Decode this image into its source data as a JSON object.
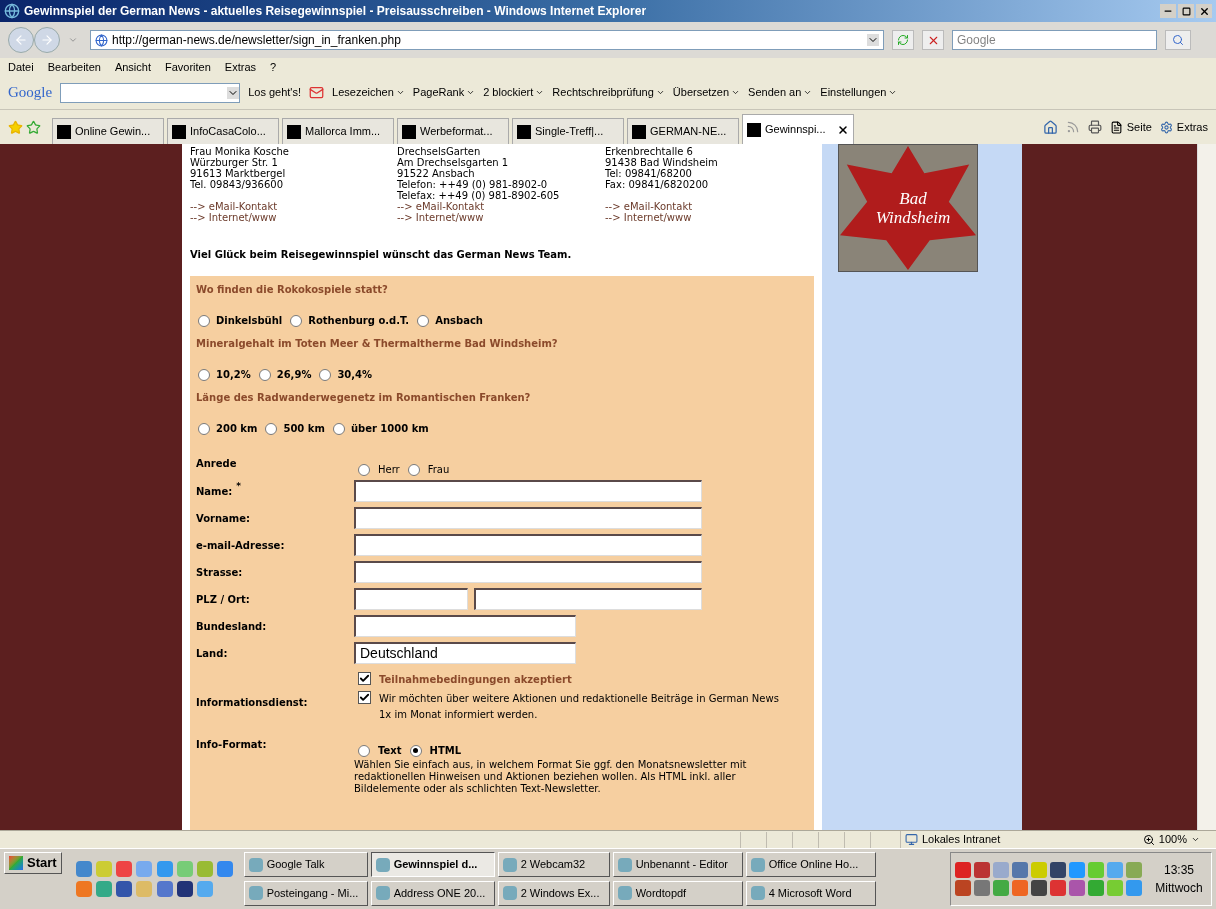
{
  "window": {
    "title": "Gewinnspiel der German News - aktuelles Reisegewinnspiel - Preisausschreiben - Windows Internet Explorer"
  },
  "address": {
    "url": "http://german-news.de/newsletter/sign_in_franken.php"
  },
  "search": {
    "placeholder": "Google"
  },
  "menu": [
    "Datei",
    "Bearbeiten",
    "Ansicht",
    "Favoriten",
    "Extras",
    "?"
  ],
  "google_toolbar": {
    "logo": "Google",
    "go": "Los geht's!",
    "items": [
      {
        "label": "Lesezeichen"
      },
      {
        "label": "PageRank"
      },
      {
        "label": "2 blockiert"
      },
      {
        "label": "Rechtschreibprüfung"
      },
      {
        "label": "Übersetzen"
      },
      {
        "label": "Senden an"
      },
      {
        "label": "Einstellungen"
      }
    ]
  },
  "tabs": [
    {
      "label": "Online Gewin...",
      "selected": false
    },
    {
      "label": "InfoCasaColo...",
      "selected": false
    },
    {
      "label": "Mallorca Imm...",
      "selected": false
    },
    {
      "label": "Werbeformat...",
      "selected": false
    },
    {
      "label": "Single-Treff|...",
      "selected": false
    },
    {
      "label": "GERMAN-NE...",
      "selected": false
    },
    {
      "label": "Gewinnspi...",
      "selected": true
    }
  ],
  "command_bar": [
    "Seite",
    "Extras"
  ],
  "contacts": [
    {
      "lines": [
        "Frau Monika Kosche",
        "Würzburger Str. 1",
        "91613 Marktbergel",
        "Tel. 09843/936600"
      ],
      "links": [
        "--> eMail-Kontakt",
        "--> Internet/www"
      ]
    },
    {
      "lines": [
        "DrechselsGarten",
        "Am Drechselsgarten 1",
        "91522 Ansbach",
        "Telefon: ++49 (0) 981-8902-0",
        "Telefax: ++49 (0) 981-8902-605"
      ],
      "links": [
        "--> eMail-Kontakt",
        "--> Internet/www"
      ]
    },
    {
      "lines": [
        "Erkenbrechtalle 6",
        "91438 Bad Windsheim",
        "Tel: 09841/68200",
        "Fax: 09841/6820200"
      ],
      "links": [
        "--> eMail-Kontakt",
        "--> Internet/www"
      ]
    }
  ],
  "greeting": "Viel Glück beim Reisegewinnspiel wünscht das German News Team.",
  "banner": {
    "text": "Bad Windsheim"
  },
  "questions": [
    {
      "question": "Wo finden die Rokokospiele statt?",
      "options": [
        {
          "label": "Dinkelsbühl",
          "selected": false
        },
        {
          "label": "Rothenburg o.d.T.",
          "selected": false
        },
        {
          "label": "Ansbach",
          "selected": false
        }
      ]
    },
    {
      "question": "Mineralgehalt im Toten Meer & Thermaltherme Bad Windsheim?",
      "options": [
        {
          "label": "10,2%",
          "selected": false
        },
        {
          "label": "26,9%",
          "selected": false
        },
        {
          "label": "30,4%",
          "selected": false
        }
      ]
    },
    {
      "question": "Länge des Radwanderwegenetz im Romantischen Franken?",
      "options": [
        {
          "label": "200 km",
          "selected": false
        },
        {
          "label": "500 km",
          "selected": false
        },
        {
          "label": "über 1000 km",
          "selected": false
        }
      ]
    }
  ],
  "form": [
    {
      "kind": "radio",
      "label": "Anrede",
      "options": [
        {
          "label": "Herr",
          "selected": false
        },
        {
          "label": "Frau",
          "selected": false
        }
      ]
    },
    {
      "kind": "long_field",
      "label": "Name:",
      "mark": "*"
    },
    {
      "kind": "long_field",
      "label": "Vorname:"
    },
    {
      "kind": "long_field",
      "label": "e-mail-Adresse:"
    },
    {
      "kind": "long_field",
      "label": "Strasse:"
    },
    {
      "kind": "split_field",
      "label": "PLZ / Ort:"
    },
    {
      "kind": "short_field",
      "label": "Bundesland:"
    },
    {
      "kind": "short_field",
      "label": "Land:",
      "value": "Deutschland"
    },
    {
      "kind": "terms",
      "text": "Teilnahmebedingungen akzeptiert",
      "checked": true
    },
    {
      "kind": "checkbox",
      "label": "Informationsdienst:",
      "text": "Wir möchten über weitere Aktionen und redaktionelle Beiträge in German News 1x im Monat informiert werden.",
      "checked": true
    },
    {
      "kind": "radio_bold",
      "label": "Info-Format:",
      "options": [
        {
          "label": "Text",
          "selected": false
        },
        {
          "label": "HTML",
          "selected": true
        }
      ],
      "description": "Wählen Sie einfach aus, in welchem Format Sie ggf. den Monatsnewsletter mit redaktionellen Hinweisen und Aktionen beziehen wollen. Als HTML inkl. aller Bildelemente oder als schlichten Text-Newsletter."
    }
  ],
  "status_bar": {
    "zone": "Lokales Intranet",
    "zoom": "100%"
  },
  "taskbar": {
    "start": "Start",
    "buttons": [
      {
        "label": "Google Talk",
        "selected": false
      },
      {
        "label": "Gewinnspiel d...",
        "selected": true
      },
      {
        "label": "2 Webcam32",
        "selected": false
      },
      {
        "label": "Unbenannt - Editor",
        "selected": false
      },
      {
        "label": "Office Online Ho...",
        "selected": false
      },
      {
        "label": "Posteingang - Mi...",
        "selected": false
      },
      {
        "label": "Address ONE 20...",
        "selected": false
      },
      {
        "label": "2 Windows Ex...",
        "selected": false
      },
      {
        "label": "Wordtopdf",
        "selected": false
      },
      {
        "label": "4 Microsoft Word",
        "selected": false
      }
    ],
    "time": "13:35",
    "day": "Mittwoch"
  }
}
